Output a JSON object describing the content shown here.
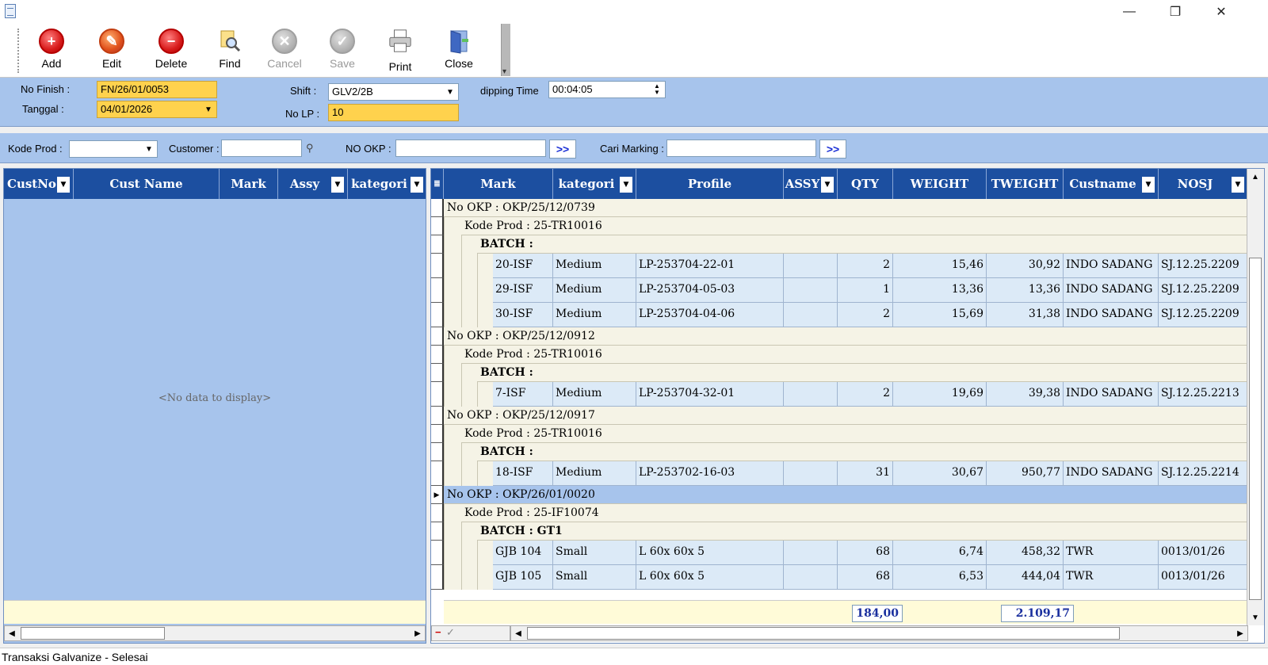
{
  "toolbar": {
    "add": "Add",
    "edit": "Edit",
    "delete": "Delete",
    "find": "Find",
    "cancel": "Cancel",
    "save": "Save",
    "print": "Print",
    "close": "Close"
  },
  "form": {
    "no_finish_label": "No Finish :",
    "no_finish_value": "FN/26/01/0053",
    "tanggal_label": "Tanggal :",
    "tanggal_value": "04/01/2026",
    "shift_label": "Shift :",
    "shift_value": "GLV2/2B",
    "nolp_label": "No LP :",
    "nolp_value": "10",
    "dipping_label": "dipping Time",
    "dipping_value": "00:04:05"
  },
  "filter": {
    "kode_prod_label": "Kode Prod :",
    "kode_prod_value": "",
    "customer_label": "Customer :",
    "customer_value": "",
    "no_okp_label": "NO OKP :",
    "no_okp_value": "",
    "cari_marking_label": "Cari Marking :",
    "cari_marking_value": "",
    "go_label": ">>"
  },
  "left_grid": {
    "columns": [
      "CustNo",
      "Cust Name",
      "Mark",
      "Assy",
      "kategori"
    ],
    "empty_text": "<No data to display>"
  },
  "right_grid": {
    "columns": [
      "Mark",
      "kategori",
      "Profile",
      "ASSY",
      "QTY",
      "WEIGHT",
      "TWEIGHT",
      "Custname",
      "NOSJ"
    ],
    "groups": [
      {
        "okp": "No OKP : OKP/25/12/0739",
        "kode": "Kode Prod : 25-TR10016",
        "batch": "BATCH :",
        "rows": [
          [
            "20-ISF",
            "Medium",
            "LP-253704-22-01",
            "",
            "2",
            "15,46",
            "30,92",
            "INDO SADANG",
            "SJ.12.25.2209"
          ],
          [
            "29-ISF",
            "Medium",
            "LP-253704-05-03",
            "",
            "1",
            "13,36",
            "13,36",
            "INDO SADANG",
            "SJ.12.25.2209"
          ],
          [
            "30-ISF",
            "Medium",
            "LP-253704-04-06",
            "",
            "2",
            "15,69",
            "31,38",
            "INDO SADANG",
            "SJ.12.25.2209"
          ]
        ]
      },
      {
        "okp": "No OKP : OKP/25/12/0912",
        "kode": "Kode Prod : 25-TR10016",
        "batch": "BATCH :",
        "rows": [
          [
            "7-ISF",
            "Medium",
            "LP-253704-32-01",
            "",
            "2",
            "19,69",
            "39,38",
            "INDO SADANG",
            "SJ.12.25.2213"
          ]
        ]
      },
      {
        "okp": "No OKP : OKP/25/12/0917",
        "kode": "Kode Prod : 25-TR10016",
        "batch": "BATCH :",
        "rows": [
          [
            "18-ISF",
            "Medium",
            "LP-253702-16-03",
            "",
            "31",
            "30,67",
            "950,77",
            "INDO SADANG",
            "SJ.12.25.2214"
          ]
        ]
      },
      {
        "okp": "No OKP : OKP/26/01/0020",
        "kode": "Kode Prod : 25-IF10074",
        "batch": "BATCH : GT1",
        "rows": [
          [
            "GJB 104",
            "Small",
            "L 60x 60x 5",
            "",
            "68",
            "6,74",
            "458,32",
            "TWR",
            "0013/01/26"
          ],
          [
            "GJB 105",
            "Small",
            "L 60x 60x 5",
            "",
            "68",
            "6,53",
            "444,04",
            "TWR",
            "0013/01/26"
          ]
        ]
      }
    ],
    "sum_qty": "184,00",
    "sum_tweight": "2.109,17"
  },
  "status": "Transaksi Galvanize - Selesai"
}
